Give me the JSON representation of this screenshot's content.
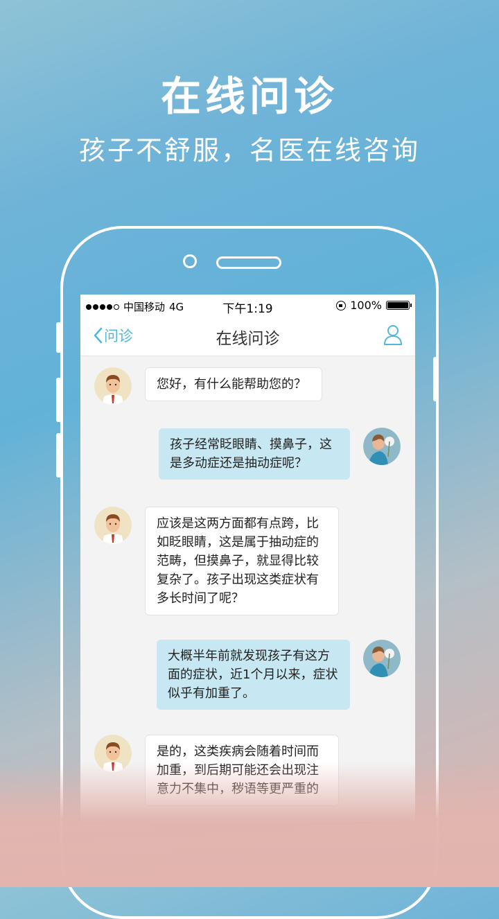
{
  "promo": {
    "headline": "在线问诊",
    "subline": "孩子不舒服，名医在线咨询"
  },
  "status_bar": {
    "carrier": "中国移动",
    "network": "4G",
    "time": "下午1:19",
    "battery": "100%"
  },
  "nav": {
    "back_label": "问诊",
    "title": "在线问诊",
    "profile_icon": "person-icon"
  },
  "chat": {
    "messages": [
      {
        "sender": "doctor",
        "text": "您好，有什么能帮助您的？"
      },
      {
        "sender": "user",
        "text": "孩子经常眨眼睛、摸鼻子，这是多动症还是抽动症呢？"
      },
      {
        "sender": "doctor",
        "text": "应该是这两方面都有点跨，比如眨眼睛，这是属于抽动症的范畴，但摸鼻子，就显得比较复杂了。孩子出现这类症状有多长时间了呢？"
      },
      {
        "sender": "user",
        "text": "大概半年前就发现孩子有这方面的症状，近1个月以来，症状似乎有加重了。"
      },
      {
        "sender": "doctor",
        "text": "是的，这类疾病会随着时间而加重，到后期可能还会出现注意力不集中，秽语等更严重的"
      }
    ]
  },
  "colors": {
    "accent": "#4fb8dc",
    "user_bubble": "#c7e8f2",
    "doctor_bubble": "#ffffff"
  }
}
